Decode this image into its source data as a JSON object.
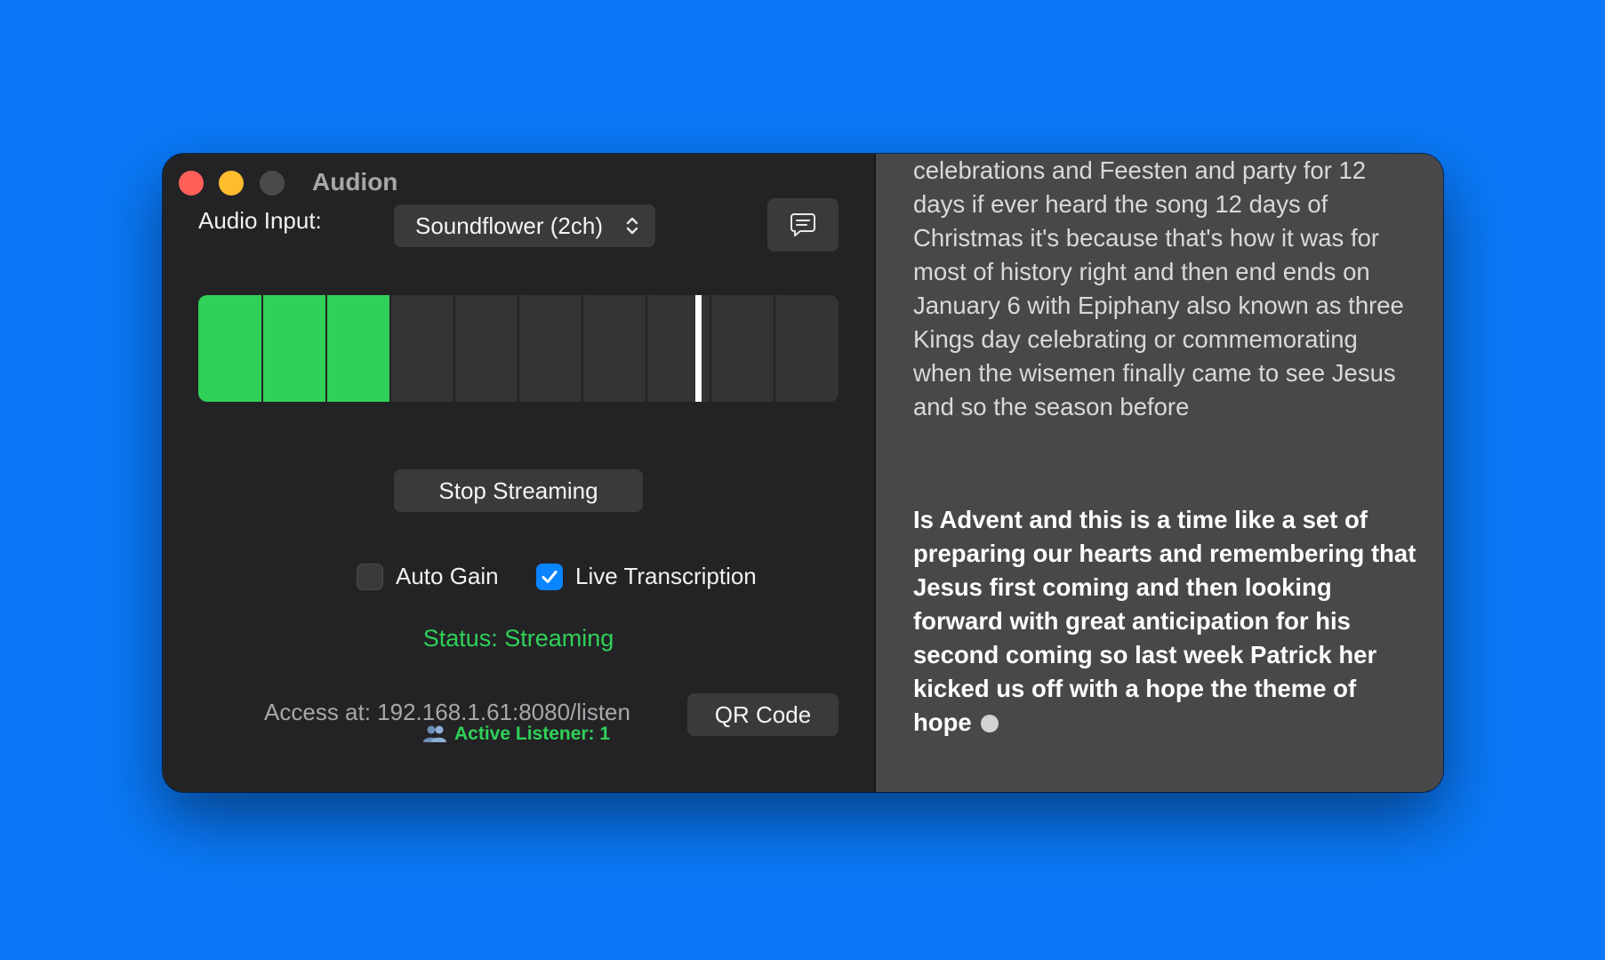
{
  "window": {
    "title": "Audion"
  },
  "controls": {
    "audio_input_label": "Audio Input:",
    "audio_input_value": "Soundflower (2ch)",
    "transcript_icon": "chat-bubble-icon"
  },
  "meter": {
    "segments": 10,
    "level_fraction": 0.3,
    "peak_fraction": 0.78,
    "level_color": "#30d158",
    "peak_color": "#ffffff"
  },
  "stream": {
    "stop_label": "Stop Streaming",
    "auto_gain_label": "Auto Gain",
    "auto_gain_checked": false,
    "live_transcription_label": "Live Transcription",
    "live_transcription_checked": true,
    "status": "Status: Streaming",
    "access": "Access at: 192.168.1.61:8080/listen",
    "listeners_icon": "people-icon",
    "listeners": "Active Listener: 1",
    "qr_label": "QR Code"
  },
  "transcript": {
    "previous": "celebrations and Feesten and party for 12 days if ever heard the song 12 days of Christmas it's because that's how it was for most of history right and then end ends on January 6 with Epiphany also known as three Kings day celebrating or commemorating when the wisemen finally came to see Jesus and so the season before",
    "current": "Is Advent and this is a time like a set of preparing our hearts and remembering that Jesus first coming and then looking forward with great anticipation for his second coming so last week Patrick her kicked us off with a hope the theme of hope"
  },
  "colors": {
    "accent_green": "#30d158",
    "accent_blue": "#0a84ff",
    "desktop": "#0a78f6"
  }
}
